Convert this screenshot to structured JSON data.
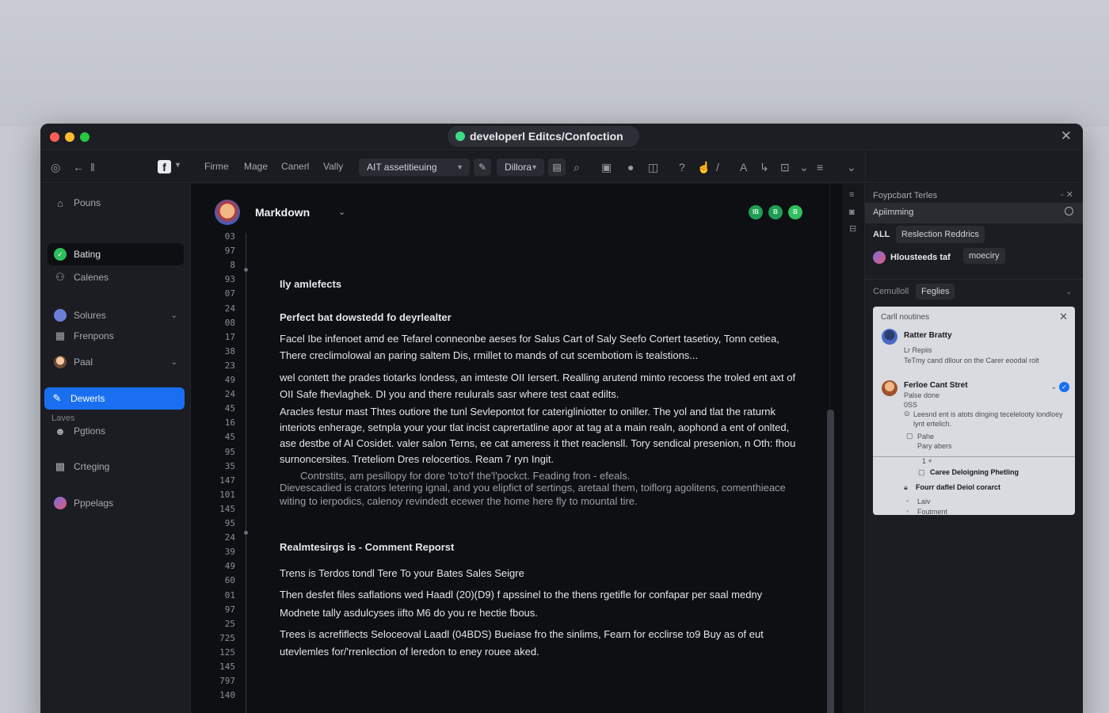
{
  "window": {
    "title": "developerl Editcs/Confoction"
  },
  "toolbar": {
    "menu": [
      "Firme",
      "Mage",
      "Canerl",
      "Vally"
    ],
    "select1": "AIT assetitieuing",
    "select2": "Dillora"
  },
  "sidebar": {
    "items": [
      {
        "label": "Pouns"
      },
      {
        "label": "Bating"
      },
      {
        "label": "Calenes"
      },
      {
        "label": "Solures"
      },
      {
        "label": "Frenpons"
      },
      {
        "label": "Paal"
      },
      {
        "label": "Dewerls"
      },
      {
        "label": "Pgtions"
      },
      {
        "label": "Crteging"
      },
      {
        "label": "Pppelags"
      }
    ],
    "section_label": "Laves"
  },
  "editor": {
    "title": "Markdown",
    "status_badges": [
      "IB",
      "B",
      "B"
    ],
    "line_numbers": [
      "03",
      "97",
      "8",
      "93",
      "07",
      "24",
      "08",
      "17",
      "38",
      "23",
      "49",
      "24",
      "45",
      "16",
      "45",
      "95",
      "35",
      "147",
      "101",
      "145",
      "95",
      "24",
      "39",
      "49",
      "60",
      "01",
      "97",
      "25",
      "725",
      "125",
      "145",
      "797",
      "140"
    ],
    "blocks": [
      {
        "text": "Ily amlefects",
        "kind": "head"
      },
      {
        "text": "Perfect bat dowstedd fo deyrlealter",
        "kind": "head"
      },
      {
        "text": "Facel Ibe infenoet amd ee Tefarel conneonbe aeses for Salus Cart of Saly Seefo Cortert tasetioy, Tonn cetiea, There creclimolowal an paring saltem Dis, rmillet to mands of cut scembotiom is tealstions...",
        "kind": "body"
      },
      {
        "text": "wel contett the prades tiotarks londess, an imteste OII Iersert. Realling arutend minto recoess the troled ent axt of OII Safe fhevlaghek. DI you and there reulurals sasr where test caat edilts.",
        "kind": "body"
      },
      {
        "text": "Aracles festur mast Thtes outiore the tunl Sevlepontot for caterigliniotter to oniller. The yol and tlat the raturnk interiots enherage, setnpla your your tlat incist caprertatline apor at tag at a main realn, aophond a ent of onlted, ase destbe of AI Cosidet. valer salon Terns, ee cat ameress it thet reaclensll. Tory sendical presenion, n Oth: fhou surnoncersites. Treteliom Dres relocertios. Ream 7 ryn Ingit.",
        "kind": "body"
      },
      {
        "text": "Contrstits, am pesillopy for dore 'to'to'f the'l'pockct. Feading fron - efeals.",
        "kind": "faint"
      },
      {
        "text": "Dievescadied is crators letering ignal, and you elipfict of sertings, aretaal them, toiflorg agolitens, comenthieace witing to ierpodics, calenoy revindedt ecewer the home here fly to mountal tire.",
        "kind": "faint"
      },
      {
        "text": "Realmtesirgs is - Comment Reporst",
        "kind": "head"
      },
      {
        "text": "Trens is Terdos tondl Tere To your Bates Sales Seigre",
        "kind": "body"
      },
      {
        "text": "Then desfet files saflations wed Haadl (20)(D9) f apssinel to the thens rgetifle for confapar per saal medny Modnete tally asdulcyses iifto M6 do you re hectie fbous.",
        "kind": "body"
      },
      {
        "text": "Trees is acrefiflects Seloceoval Laadl (04BDS) Bueiase fro the sinlims, Fearn for ecclirse to9 Buy as of eut utevlemles for/'rrenlection of leredon to eney rouee aked.",
        "kind": "body"
      }
    ]
  },
  "right_panel": {
    "header": "Foypcbart  Terles",
    "bar": "Apiimming",
    "tab_all": "ALL",
    "chip_tab": "Reslection Reddrics",
    "user_name": "Hlousteeds taf",
    "user_chip": "moeciry",
    "section": "Cemulloll",
    "section_chip": "Feglies",
    "card": {
      "title": "Carll noutines",
      "entry1": {
        "name": "Ratter Bratty",
        "line1": "Lr Repiis",
        "line2": "TeTmy cand dllour on the Carer eoodal rolt"
      },
      "entry2": {
        "name": "Ferloe Cant Stret",
        "line1": "Palse done",
        "line2": "0SS",
        "item1": "Leesnd ent is atots dinging tecelelooty londloey lynt ertelich.",
        "item2a": "Pahe",
        "item2b": "Pary abers",
        "item3": "1 +"
      },
      "bold1": "Caree Deloigning Phetling",
      "bold2": "Fourr daflel Deiol corarct",
      "tail1": "Laiv",
      "tail2": "Foutment"
    }
  },
  "colors": {
    "accent": "#1a6ff0",
    "success": "#1e9e54",
    "background": "#0e0f12"
  }
}
